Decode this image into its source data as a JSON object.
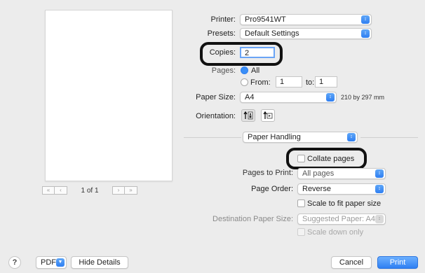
{
  "printer": {
    "label": "Printer:",
    "value": "Pro9541WT"
  },
  "presets": {
    "label": "Presets:",
    "value": "Default Settings"
  },
  "copies": {
    "label": "Copies:",
    "value": "2"
  },
  "pages": {
    "label": "Pages:",
    "all_label": "All",
    "from_label": "From:",
    "from_value": "1",
    "to_label": "to:",
    "to_value": "1",
    "selected": "all"
  },
  "paper_size": {
    "label": "Paper Size:",
    "value": "A4",
    "dimensions": "210 by 297 mm"
  },
  "orientation": {
    "label": "Orientation:",
    "selected": "portrait"
  },
  "section_menu": {
    "value": "Paper Handling"
  },
  "collate": {
    "label": "Collate pages",
    "checked": false
  },
  "pages_to_print": {
    "label": "Pages to Print:",
    "value": "All pages"
  },
  "page_order": {
    "label": "Page Order:",
    "value": "Reverse"
  },
  "scale_to_fit": {
    "label": "Scale to fit paper size",
    "checked": false
  },
  "destination_paper_size": {
    "label": "Destination Paper Size:",
    "value": "Suggested Paper: A4"
  },
  "scale_down_only": {
    "label": "Scale down only",
    "checked": false
  },
  "preview": {
    "page_indicator": "1 of 1"
  },
  "footer": {
    "help_label": "?",
    "pdf_label": "PDF",
    "hide_details_label": "Hide Details",
    "cancel_label": "Cancel",
    "print_label": "Print"
  },
  "colors": {
    "accent": "#2f7ff2",
    "background": "#ececec",
    "highlight": "#111111"
  }
}
